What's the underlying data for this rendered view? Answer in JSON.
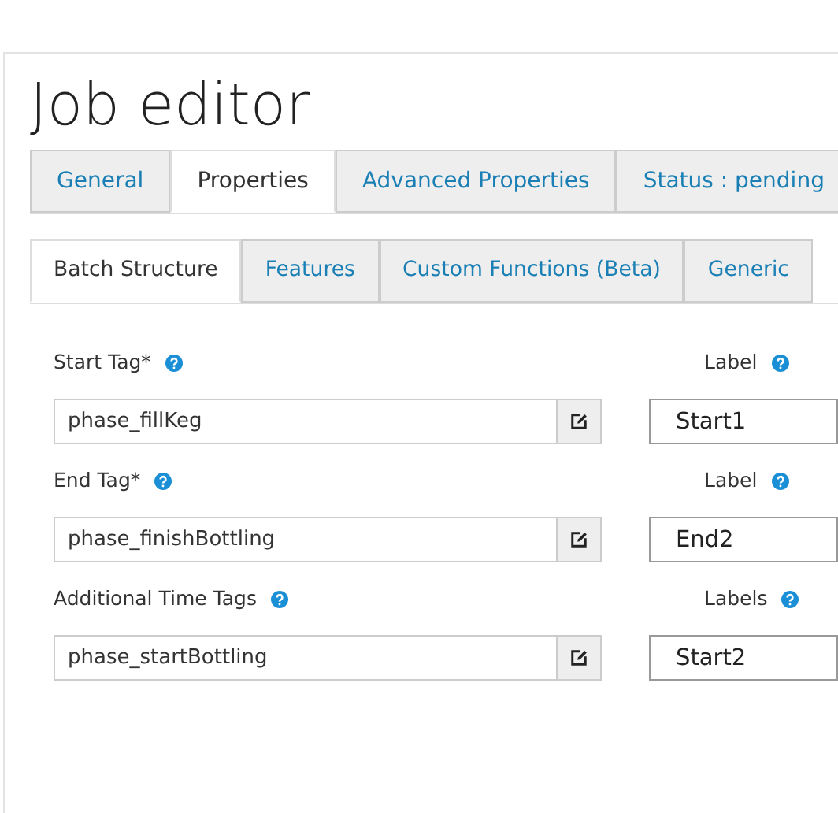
{
  "title": "Job editor",
  "tabs": [
    {
      "label": "General",
      "selected": false
    },
    {
      "label": "Properties",
      "selected": true
    },
    {
      "label": "Advanced Properties",
      "selected": false
    },
    {
      "label": "Status : pending",
      "selected": false
    }
  ],
  "subtabs": [
    {
      "label": "Batch Structure",
      "selected": true
    },
    {
      "label": "Features",
      "selected": false
    },
    {
      "label": "Custom Functions (Beta)",
      "selected": false
    },
    {
      "label": "Generic",
      "selected": false
    }
  ],
  "fields": [
    {
      "label": "Start Tag*",
      "value": "phase_fillKeg",
      "side_label": "Label",
      "side_value": "Start1"
    },
    {
      "label": "End Tag*",
      "value": "phase_finishBottling",
      "side_label": "Label",
      "side_value": "End2"
    },
    {
      "label": "Additional Time Tags",
      "value": "phase_startBottling",
      "side_label": "Labels",
      "side_value": "Start2"
    }
  ]
}
